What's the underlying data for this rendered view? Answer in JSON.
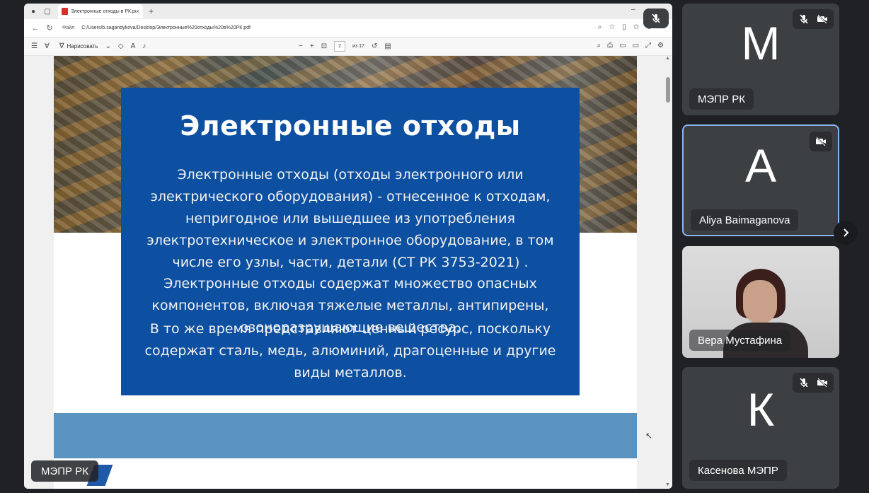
{
  "browser": {
    "tab_title": "Электронные отходы в РК.pdf",
    "tab_close": "×",
    "new_tab": "+",
    "url_prefix": "Файл",
    "url": "C:/Users/b.sagandykova/Desktop/Электронные%20отходы%20в%20РК.pdf"
  },
  "pdf_toolbar": {
    "draw_label": "Нарисовать",
    "page_current": "2",
    "page_total": "из 17"
  },
  "slide": {
    "title": "Электронные отходы",
    "paragraph1": "Электронные отходы (отходы электронного или электрического оборудования) - отнесенное к отходам, непригодное или вышедшее из употребления электротехническое и электронное оборудование, в том числе его узлы, части, детали (СТ РК 3753-2021) .",
    "paragraph2": "Электронные отходы содержат множество опасных компонентов, включая тяжелые металлы, антипирены, озоноразрущающие вещества.",
    "paragraph3": "В то же время представляют ценный ресурс, поскольку содержат сталь, медь, алюминий, драгоценные и другие виды металлов."
  },
  "presenter": {
    "name": "МЭПР РК"
  },
  "participants": [
    {
      "initial": "М",
      "name": "МЭПР РК",
      "muted": true,
      "camera_off": true
    },
    {
      "initial": "A",
      "name": "Aliya Baimaganova",
      "muted": false,
      "camera_off": true,
      "active": true
    },
    {
      "name": "Вера Мустафина",
      "video": true
    },
    {
      "initial": "К",
      "name": "Касенова МЭПР",
      "muted": true,
      "camera_off": true
    }
  ],
  "colors": {
    "slide_blue": "#0d4fa0",
    "band_blue": "#5b93c0",
    "tile_bg": "#3c4043",
    "active_border": "#8ab4f8",
    "app_bg": "#202124"
  }
}
